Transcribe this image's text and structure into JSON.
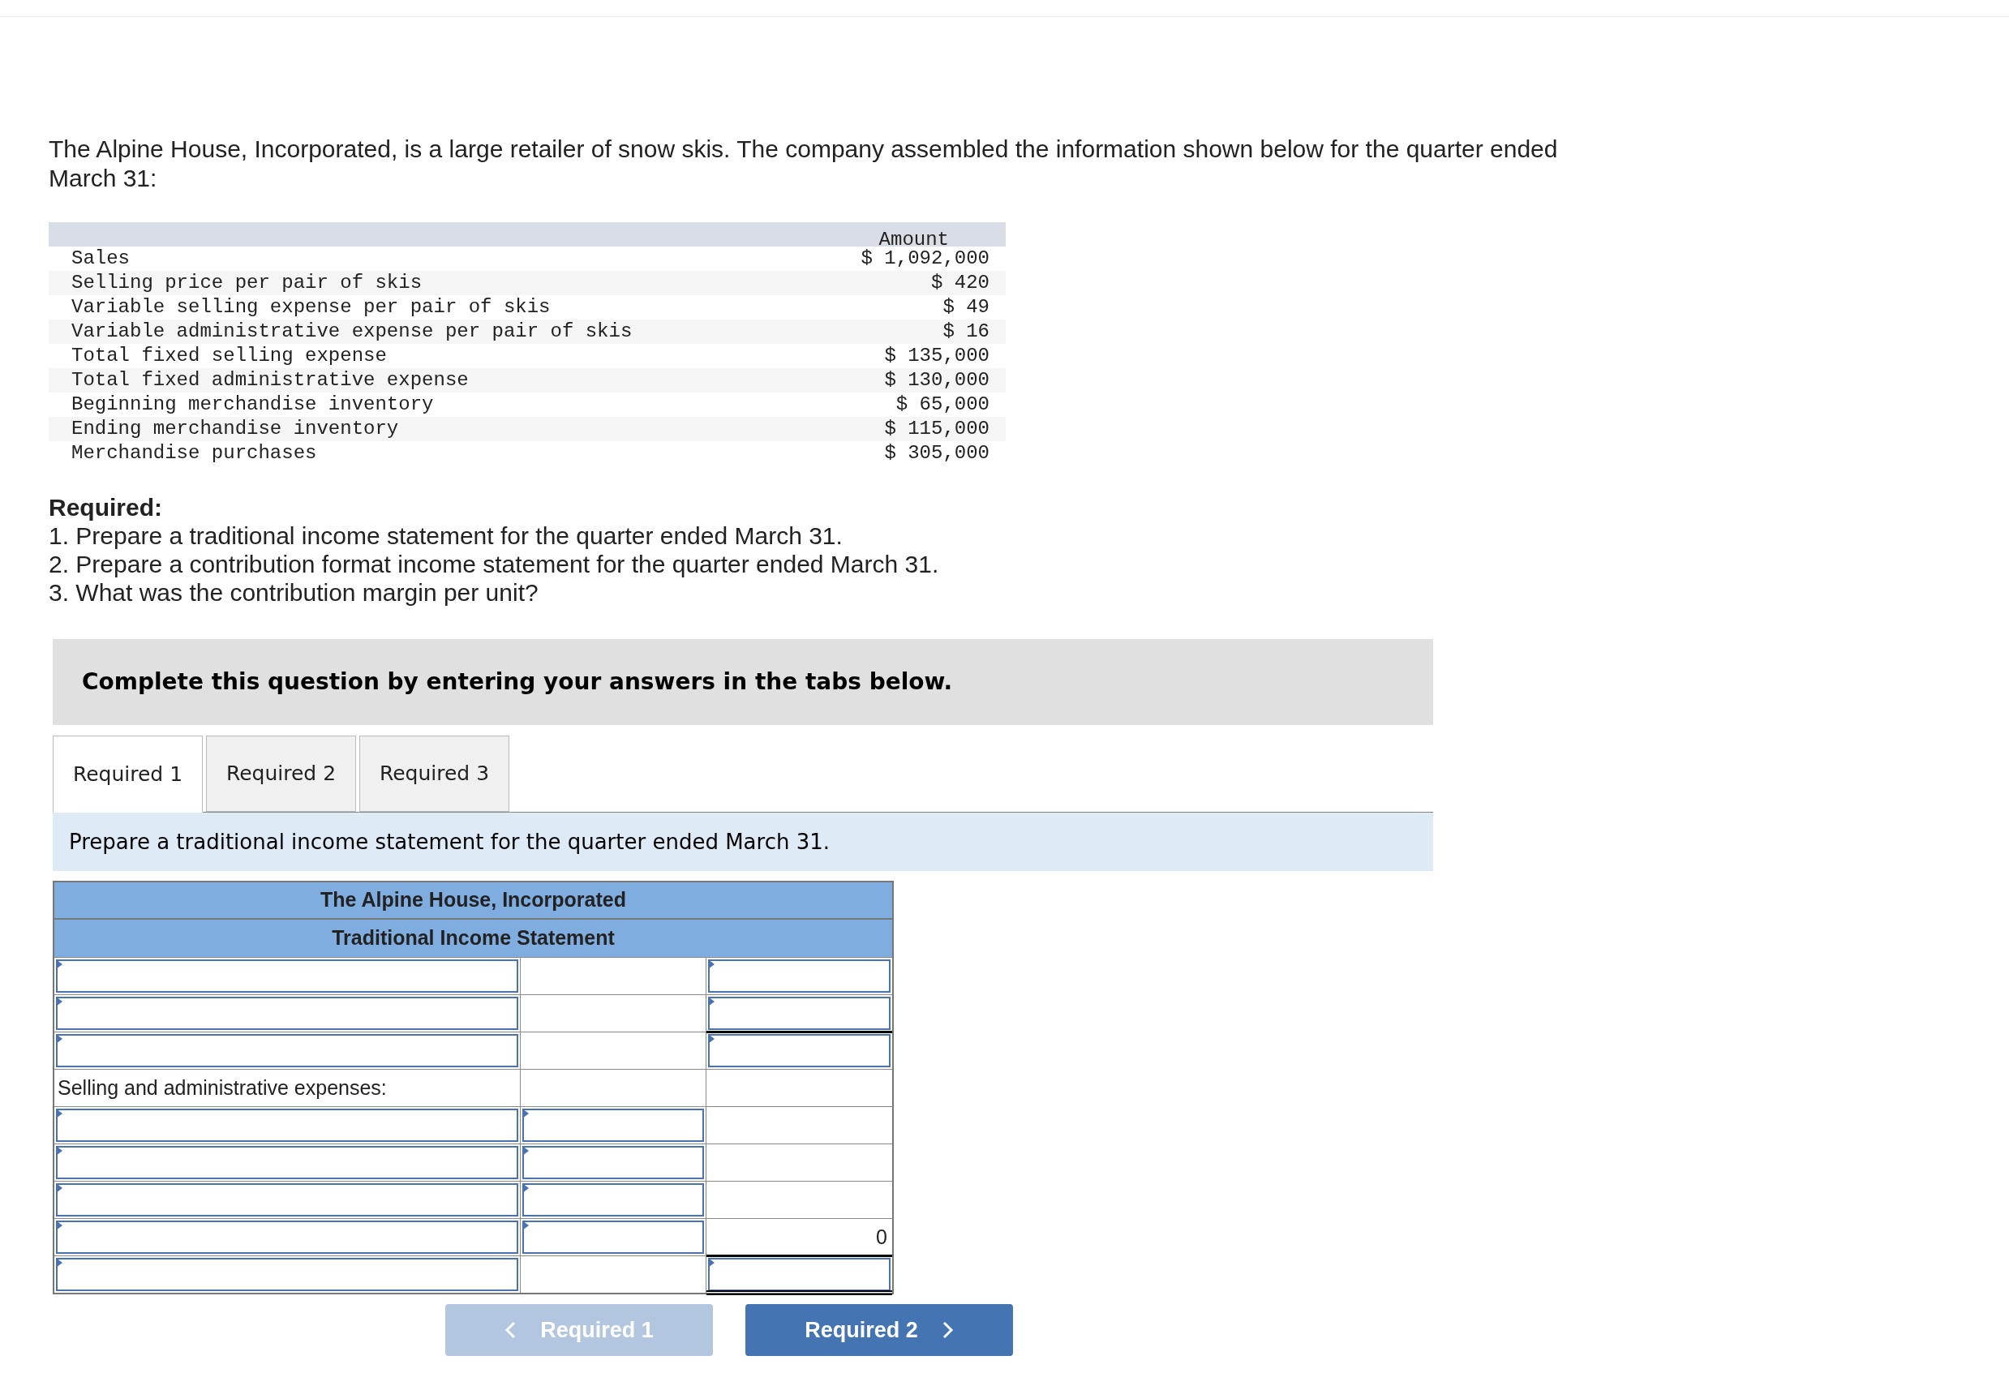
{
  "intro": "The Alpine House, Incorporated, is a large retailer of snow skis. The company assembled the information shown below for the quarter ended March 31:",
  "data_table": {
    "columns": [
      "Amount"
    ],
    "rows": [
      {
        "label": "Sales",
        "amount": "$ 1,092,000"
      },
      {
        "label": "Selling price per pair of skis",
        "amount": "$ 420"
      },
      {
        "label": "Variable selling expense per pair of skis",
        "amount": "$ 49"
      },
      {
        "label": "Variable administrative expense per pair of skis",
        "amount": "$ 16"
      },
      {
        "label": "Total fixed selling expense",
        "amount": "$ 135,000"
      },
      {
        "label": "Total fixed administrative expense",
        "amount": "$ 130,000"
      },
      {
        "label": "Beginning merchandise inventory",
        "amount": "$ 65,000"
      },
      {
        "label": "Ending merchandise inventory",
        "amount": "$ 115,000"
      },
      {
        "label": "Merchandise purchases",
        "amount": "$ 305,000"
      }
    ]
  },
  "required": {
    "heading": "Required:",
    "items": [
      "1. Prepare a traditional income statement for the quarter ended March 31.",
      "2. Prepare a contribution format income statement for the quarter ended March 31.",
      "3. What was the contribution margin per unit?"
    ]
  },
  "banner": "Complete this question by entering your answers in the tabs below.",
  "tabs": [
    {
      "label": "Required 1",
      "selected": true
    },
    {
      "label": "Required 2",
      "selected": false
    },
    {
      "label": "Required 3",
      "selected": false
    }
  ],
  "instruction": "Prepare a traditional income statement for the quarter ended March 31.",
  "statement": {
    "title": "The Alpine House, Incorporated",
    "subtitle": "Traditional Income Statement",
    "rows": [
      [
        {
          "kind": "input"
        },
        {
          "kind": "empty"
        },
        {
          "kind": "input"
        }
      ],
      [
        {
          "kind": "input"
        },
        {
          "kind": "empty"
        },
        {
          "kind": "input",
          "underlined": true
        }
      ],
      [
        {
          "kind": "input"
        },
        {
          "kind": "empty"
        },
        {
          "kind": "input"
        }
      ],
      [
        {
          "kind": "text",
          "text": "Selling and administrative expenses:"
        },
        {
          "kind": "empty"
        },
        {
          "kind": "empty"
        }
      ],
      [
        {
          "kind": "input"
        },
        {
          "kind": "input"
        },
        {
          "kind": "empty"
        }
      ],
      [
        {
          "kind": "input"
        },
        {
          "kind": "input"
        },
        {
          "kind": "empty"
        }
      ],
      [
        {
          "kind": "input"
        },
        {
          "kind": "input"
        },
        {
          "kind": "empty"
        }
      ],
      [
        {
          "kind": "input"
        },
        {
          "kind": "input"
        },
        {
          "kind": "number",
          "text": "0",
          "underlined": true
        }
      ],
      [
        {
          "kind": "input"
        },
        {
          "kind": "empty"
        },
        {
          "kind": "input",
          "double_underlined": true
        }
      ]
    ]
  },
  "nav": [
    {
      "label": "Required 1",
      "kind": "prev",
      "disabled": true
    },
    {
      "label": "Required 2",
      "kind": "next",
      "disabled": false
    }
  ]
}
